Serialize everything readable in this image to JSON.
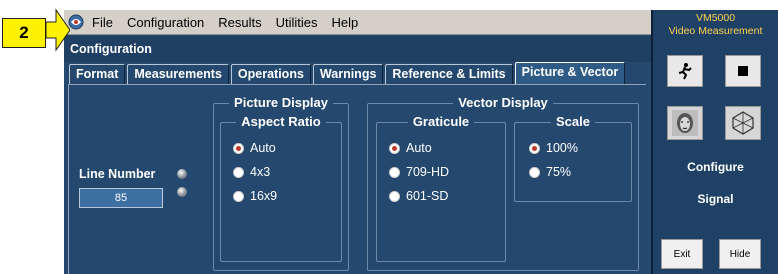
{
  "callout": {
    "number": "2"
  },
  "menu": {
    "items": [
      "File",
      "Configuration",
      "Results",
      "Utilities",
      "Help"
    ]
  },
  "config": {
    "title": "Configuration",
    "tabs": [
      {
        "label": "Format"
      },
      {
        "label": "Measurements"
      },
      {
        "label": "Operations"
      },
      {
        "label": "Warnings"
      },
      {
        "label": "Reference & Limits"
      },
      {
        "label": "Picture & Vector"
      }
    ],
    "active_tab": "Picture & Vector"
  },
  "line_number": {
    "label": "Line Number",
    "value": "85"
  },
  "picture_display": {
    "title": "Picture Display",
    "aspect_ratio": {
      "title": "Aspect Ratio",
      "options": [
        "Auto",
        "4x3",
        "16x9"
      ],
      "selected": "Auto"
    }
  },
  "vector_display": {
    "title": "Vector Display",
    "graticule": {
      "title": "Graticule",
      "options": [
        "Auto",
        "709-HD",
        "601-SD"
      ],
      "selected": "Auto"
    },
    "scale": {
      "title": "Scale",
      "options": [
        "100%",
        "75%"
      ],
      "selected": "100%"
    }
  },
  "side_panel": {
    "title_line1": "VM5000",
    "title_line2": "Video Measurement",
    "configure_label": "Configure",
    "signal_label": "Signal",
    "exit_label": "Exit",
    "hide_label": "Hide"
  },
  "colors": {
    "callout": "#fff200",
    "panel_bg": "#25496e",
    "menubar_bg": "#d4d0c8",
    "side_title": "#ffd24d"
  }
}
